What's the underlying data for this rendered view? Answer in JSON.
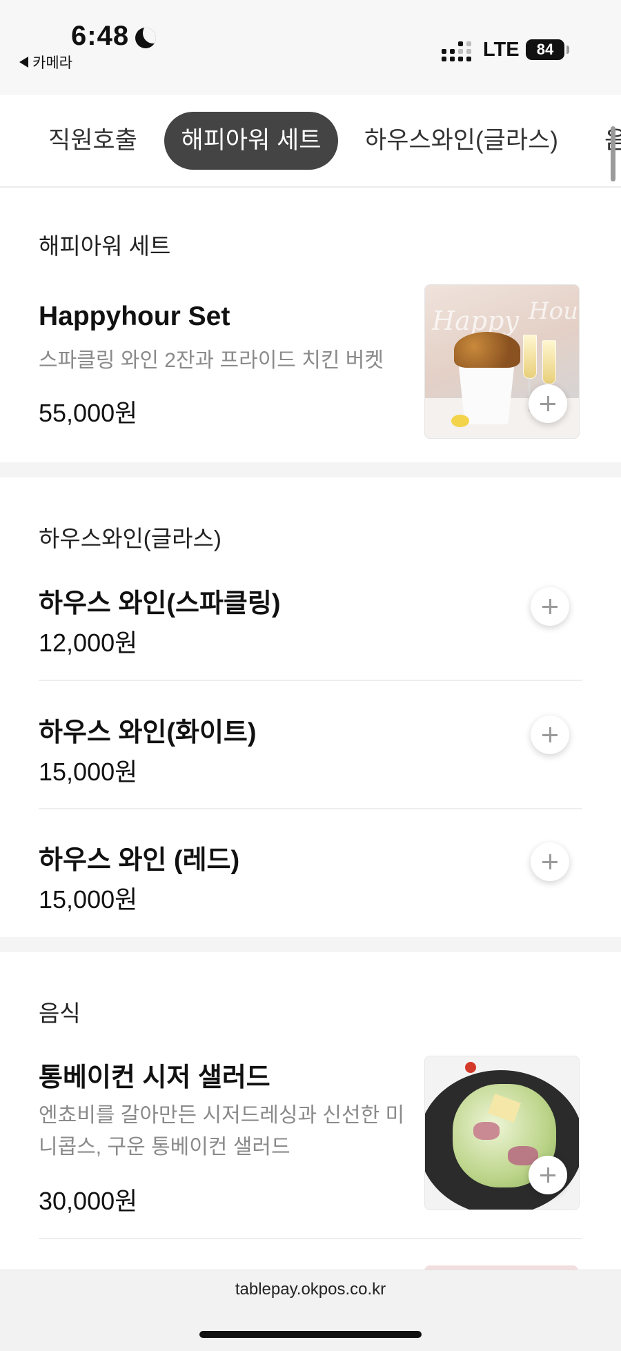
{
  "status_bar": {
    "time": "6:48",
    "back_label": "카메라",
    "network": "LTE",
    "battery": "84"
  },
  "tabs": [
    {
      "label": "직원호출",
      "selected": false
    },
    {
      "label": "해피아워 세트",
      "selected": true
    },
    {
      "label": "하우스와인(글라스)",
      "selected": false
    },
    {
      "label": "음",
      "selected": false
    }
  ],
  "sections": [
    {
      "title": "해피아워 세트",
      "items": [
        {
          "name": "Happyhour Set",
          "description": "스파클링 와인 2잔과 프라이드 치킨 버켓",
          "price": "55,000원",
          "thumb_text_1": "Happy",
          "thumb_text_2": "Hour"
        }
      ]
    },
    {
      "title": "하우스와인(글라스)",
      "items": [
        {
          "name": "하우스 와인(스파클링)",
          "price": "12,000원"
        },
        {
          "name": "하우스 와인(화이트)",
          "price": "15,000원"
        },
        {
          "name": "하우스 와인 (레드)",
          "price": "15,000원"
        }
      ]
    },
    {
      "title": "음식",
      "items": [
        {
          "name": "통베이컨 시저 샐러드",
          "description": "엔쵸비를 갈아만든 시저드레싱과 신선한 미니콥스, 구운 통베이컨 샐러드",
          "price": "30,000원"
        }
      ]
    }
  ],
  "url": "tablepay.okpos.co.kr",
  "colors": {
    "selected_tab_bg": "#444444",
    "section_gap": "#f4f4f4",
    "desc_text": "#8a8a8a"
  }
}
